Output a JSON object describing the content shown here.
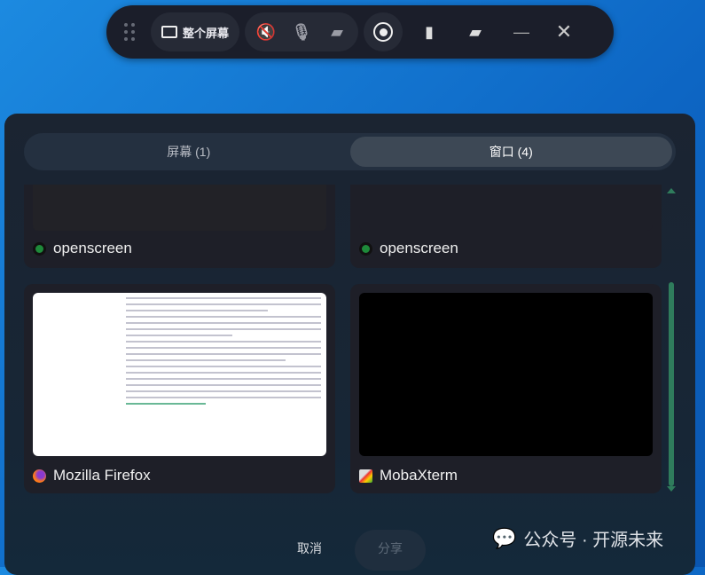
{
  "toolbar": {
    "source_label": "整个屏幕",
    "icons": [
      "drag-handle",
      "monitor",
      "speaker-muted",
      "mic-muted",
      "camera-off",
      "record",
      "file-video",
      "folder-open",
      "minimize",
      "close"
    ]
  },
  "tabs": [
    {
      "label": "屏幕 (1)",
      "active": false
    },
    {
      "label": "窗口 (4)",
      "active": true
    }
  ],
  "windows": [
    {
      "title": "openscreen",
      "icon": "openscreen-icon"
    },
    {
      "title": "openscreen",
      "icon": "openscreen-icon"
    },
    {
      "title": "Mozilla Firefox",
      "icon": "firefox-icon"
    },
    {
      "title": "MobaXterm",
      "icon": "mobaxterm-icon"
    }
  ],
  "actions": {
    "cancel": "取消",
    "share": "分享"
  },
  "watermark": "公众号 · 开源未来",
  "colors": {
    "accent": "#2f7c5c",
    "toolbar": "#1b1e2a"
  }
}
